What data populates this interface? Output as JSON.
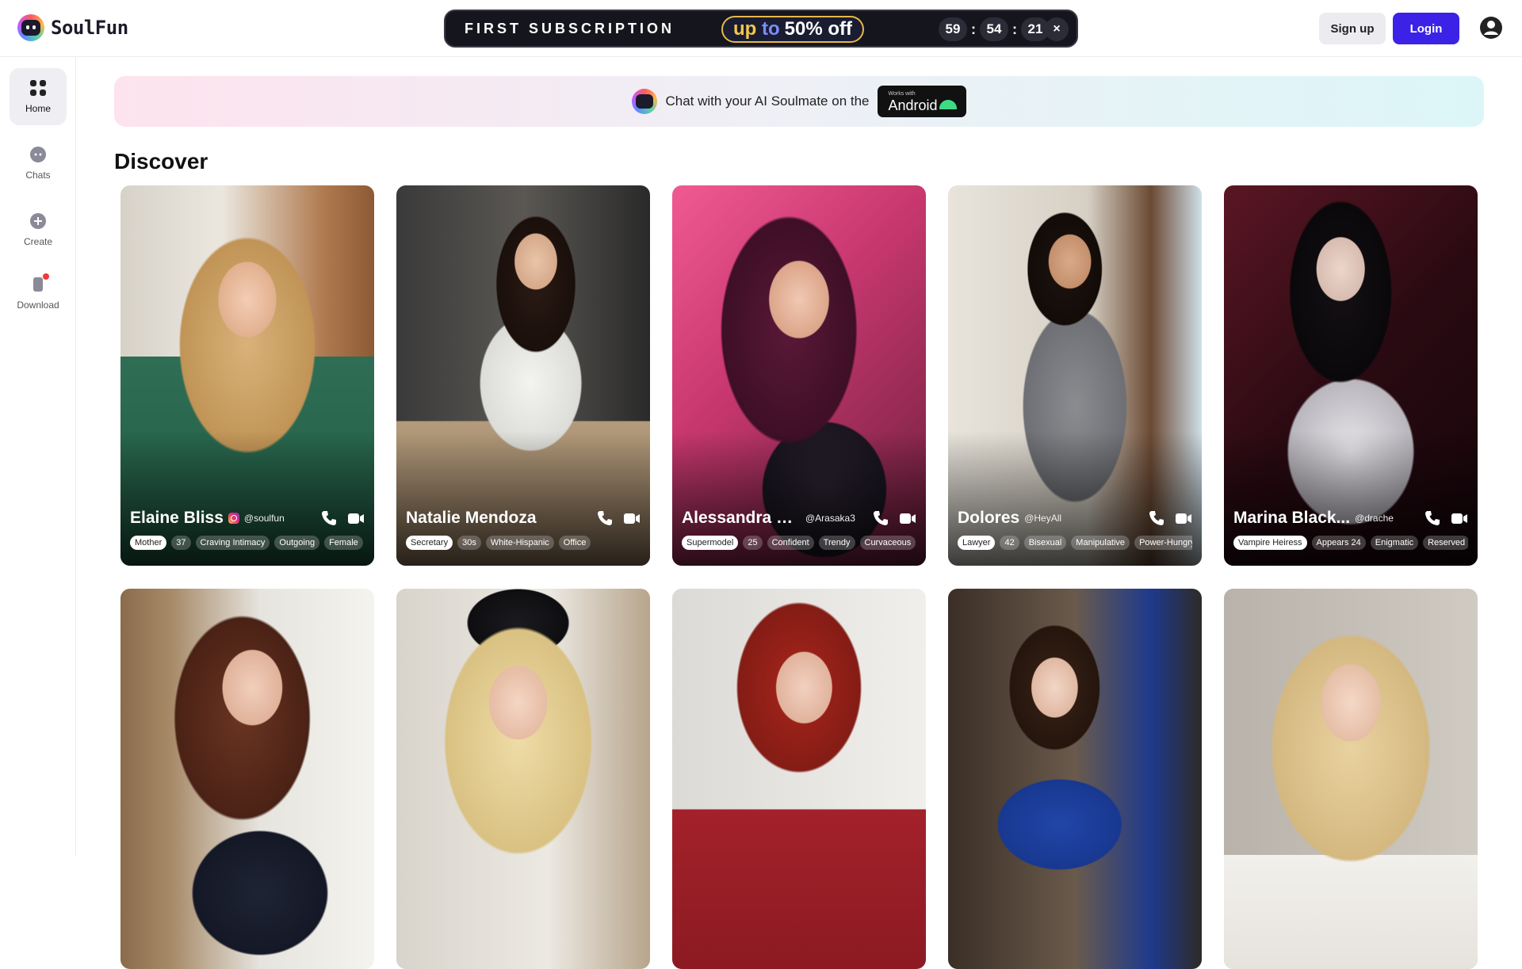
{
  "app": {
    "name": "SoulFun"
  },
  "promo": {
    "title": "FIRST SUBSCRIPTION",
    "up": "up",
    "to": "to",
    "off": "50% off",
    "timer": [
      "59",
      "54",
      "21"
    ],
    "close": "×"
  },
  "auth": {
    "signup": "Sign up",
    "login": "Login"
  },
  "sidebar": {
    "items": [
      {
        "label": "Home",
        "icon": "grid-icon",
        "active": true
      },
      {
        "label": "Chats",
        "icon": "chat-icon"
      },
      {
        "label": "Create",
        "icon": "plus-icon"
      },
      {
        "label": "Download",
        "icon": "phone-icon",
        "badge": true
      }
    ]
  },
  "banner": {
    "text": "Chat with your AI Soulmate on the",
    "badge_small": "Works with",
    "badge_big": "Android"
  },
  "discover": {
    "title": "Discover",
    "cards": [
      {
        "name": "Elaine Bliss",
        "handle": "@soulfun",
        "instagram": true,
        "tags": [
          "Mother",
          "37",
          "Craving Intimacy",
          "Outgoing",
          "Female"
        ]
      },
      {
        "name": "Natalie Mendoza",
        "handle": "",
        "tags": [
          "Secretary",
          "30s",
          "White-Hispanic",
          "Office"
        ]
      },
      {
        "name": "Alessandra Be...",
        "handle": "@Arasaka3",
        "tags": [
          "Supermodel",
          "25",
          "Confident",
          "Trendy",
          "Curvaceous"
        ]
      },
      {
        "name": "Dolores",
        "handle": "@HeyAll",
        "tags": [
          "Lawyer",
          "42",
          "Bisexual",
          "Manipulative",
          "Power-Hungry"
        ]
      },
      {
        "name": "Marina Black...",
        "handle": "@drache",
        "tags": [
          "Vampire Heiress",
          "Appears 24",
          "Enigmatic",
          "Reserved"
        ]
      },
      {
        "name": "",
        "handle": "",
        "tags": []
      },
      {
        "name": "",
        "handle": "",
        "tags": []
      },
      {
        "name": "",
        "handle": "",
        "tags": []
      },
      {
        "name": "",
        "handle": "",
        "tags": []
      },
      {
        "name": "",
        "handle": "",
        "tags": []
      }
    ]
  },
  "colors": {
    "brand": "#3b22e6",
    "promo_bg": "#15151d",
    "android": "#3ddc84"
  }
}
